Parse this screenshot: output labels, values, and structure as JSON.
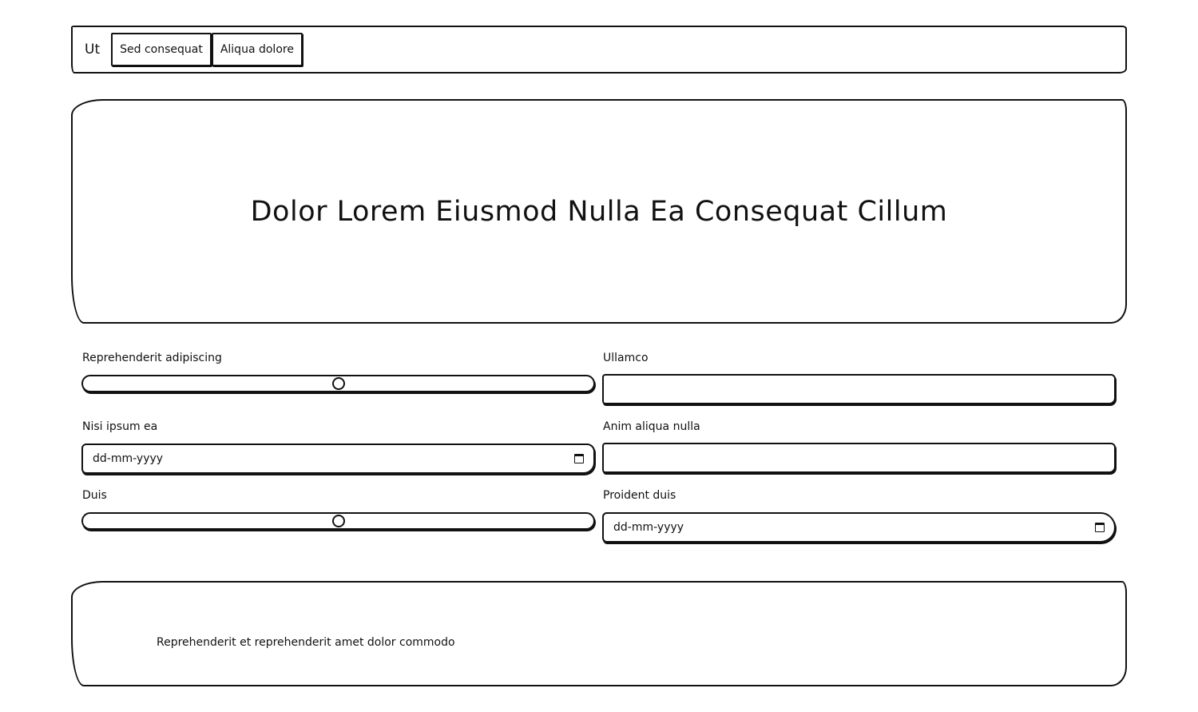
{
  "nav": {
    "brand": "Ut",
    "buttons": [
      "Sed consequat",
      "Aliqua dolore"
    ]
  },
  "hero": {
    "title": "Dolor Lorem Eiusmod Nulla Ea Consequat Cillum"
  },
  "form": {
    "fields": [
      {
        "label": "Reprehenderit adipiscing",
        "type": "range",
        "value": 0.5
      },
      {
        "label": "Ullamco",
        "type": "text",
        "value": ""
      },
      {
        "label": "Nisi ipsum ea",
        "type": "date",
        "placeholder": "dd-mm-yyyy"
      },
      {
        "label": "Anim aliqua nulla",
        "type": "text",
        "value": ""
      },
      {
        "label": "Duis",
        "type": "range",
        "value": 0.5
      },
      {
        "label": "Proident duis",
        "type": "date",
        "placeholder": "dd-mm-yyyy"
      }
    ]
  },
  "footer": {
    "text": "Reprehenderit et reprehenderit amet dolor commodo"
  }
}
